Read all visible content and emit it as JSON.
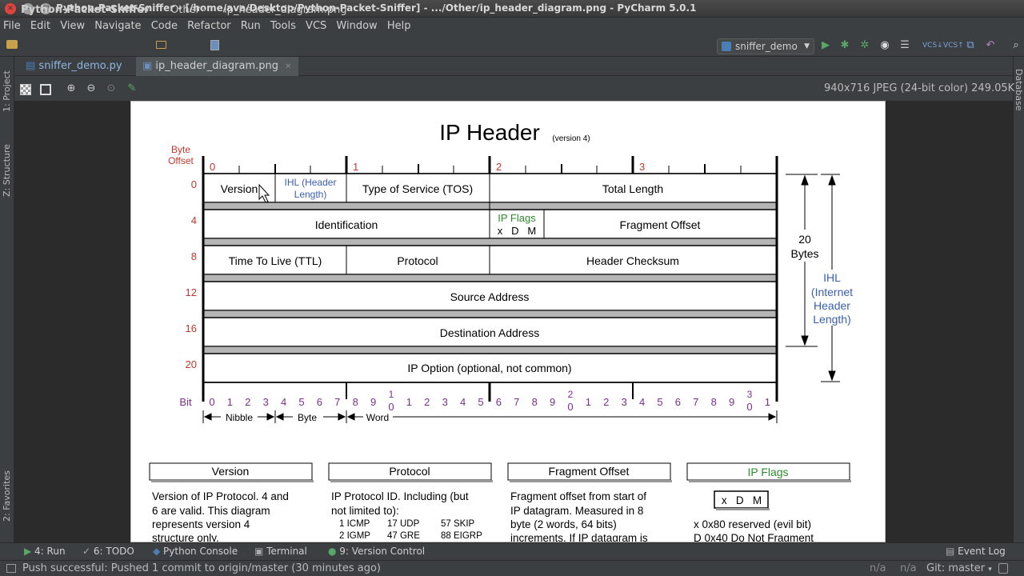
{
  "window": {
    "title": "Python-Packet-Sniffer - [/home/ava/Desktop/Python-Packet-Sniffer] - .../Other/ip_header_diagram.png - PyCharm 5.0.1"
  },
  "menu": [
    "File",
    "Edit",
    "View",
    "Navigate",
    "Code",
    "Refactor",
    "Run",
    "Tools",
    "VCS",
    "Window",
    "Help"
  ],
  "breadcrumb": {
    "project": "Python-Packet-Sniffer",
    "folder": "Other",
    "file": "ip_header_diagram.png"
  },
  "run_config": "sniffer_demo",
  "toolbar_icons": [
    "run-icon",
    "debug-icon",
    "coverage-icon",
    "profile-icon",
    "tasks-icon",
    "vcs-update-icon",
    "vcs-commit-icon",
    "compare-icon",
    "revert-icon",
    "search-icon"
  ],
  "tabs": [
    {
      "label": "sniffer_demo.py",
      "active": false
    },
    {
      "label": "ip_header_diagram.png",
      "active": true
    }
  ],
  "image_info": "940x716 JPEG (24-bit color) 249.05K",
  "left_panels": {
    "project": "1: Project",
    "structure": "Z: Structure",
    "favorites": "2: Favorites"
  },
  "right_panels": {
    "database": "Database"
  },
  "bottom_tools": [
    {
      "num": "4",
      "label": "Run"
    },
    {
      "num": "6",
      "label": "TODO"
    },
    {
      "num": "",
      "label": "Python Console"
    },
    {
      "num": "",
      "label": "Terminal"
    },
    {
      "num": "9",
      "label": "Version Control"
    }
  ],
  "event_log": "Event Log",
  "status": {
    "message": "Push successful: Pushed 1 commit to origin/master (30 minutes ago)",
    "na1": "n/a",
    "na2": "n/a",
    "git": "Git: master"
  },
  "diagram": {
    "title": "IP Header",
    "version": "(version 4)",
    "byte_offset": [
      "Byte",
      "Offset"
    ],
    "byte_nums": [
      "0",
      "1",
      "2",
      "3"
    ],
    "row_offsets": [
      "0",
      "4",
      "8",
      "12",
      "16",
      "20"
    ],
    "fields": {
      "version": "Version",
      "ihl1": "IHL (Header",
      "ihl2": "Length)",
      "tos": "Type of Service (TOS)",
      "total_length": "Total Length",
      "identification": "Identification",
      "ip_flags": "IP Flags",
      "flags_bits": "x   D   M",
      "fragment_offset": "Fragment Offset",
      "ttl": "Time To Live (TTL)",
      "protocol": "Protocol",
      "checksum": "Header Checksum",
      "source": "Source Address",
      "destination": "Destination Address",
      "option": "IP Option (optional, not common)"
    },
    "side": {
      "bytes_num": "20",
      "bytes_word": "Bytes",
      "ihl": [
        "IHL",
        "(Internet",
        "Header",
        "Length)"
      ]
    },
    "bit_label": "Bit",
    "bit_digits": [
      "0",
      "1",
      "2",
      "3",
      "4",
      "5",
      "6",
      "7",
      "8",
      "9",
      "0",
      "1",
      "2",
      "3",
      "4",
      "5",
      "6",
      "7",
      "8",
      "9",
      "0",
      "1",
      "2",
      "3",
      "4",
      "5",
      "6",
      "7",
      "8",
      "9",
      "0",
      "1"
    ],
    "bit_tens": [
      "1",
      "2",
      "3"
    ],
    "sizes": {
      "nibble": "Nibble",
      "byte": "Byte",
      "word": "Word"
    },
    "legend": {
      "version": {
        "title": "Version",
        "lines": [
          "Version of IP Protocol.  4 and",
          "6 are valid.  This diagram",
          "represents version 4",
          "structure only."
        ]
      },
      "protocol": {
        "title": "Protocol",
        "lines": [
          "IP Protocol ID.  Including (but",
          "not limited to):"
        ],
        "rows": [
          [
            "1 ICMP",
            "17 UDP",
            "57 SKIP"
          ],
          [
            "2 IGMP",
            "47 GRE",
            "88 EIGRP"
          ]
        ]
      },
      "fragment": {
        "title": "Fragment Offset",
        "lines": [
          "Fragment offset from start of",
          "IP datagram.  Measured in 8",
          "byte (2 words, 64 bits)",
          "increments.  If IP datagram is"
        ]
      },
      "flags": {
        "title": "IP Flags",
        "box": "x   D   M",
        "lines": [
          "x  0x80 reserved (evil bit)",
          "D  0x40 Do Not Fragment"
        ]
      }
    }
  }
}
